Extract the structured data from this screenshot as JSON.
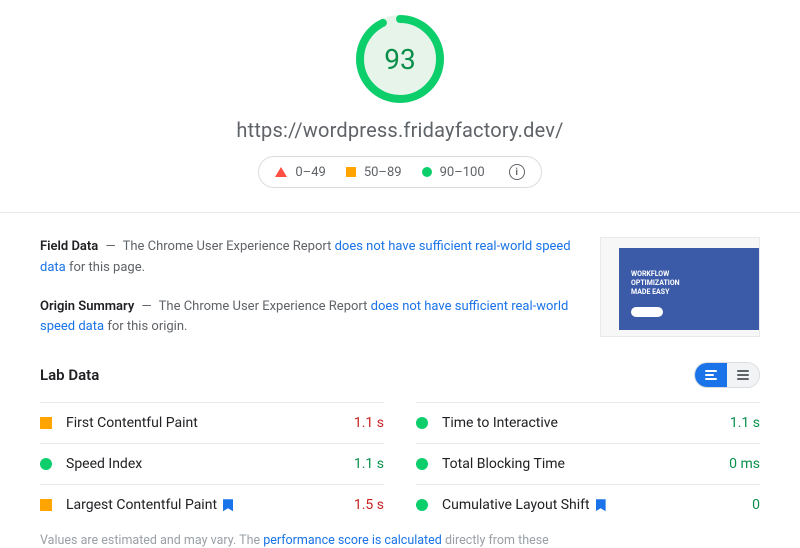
{
  "score": "93",
  "url": "https://wordpress.fridayfactory.dev/",
  "legend": {
    "poor": "0–49",
    "mid": "50–89",
    "good": "90–100"
  },
  "field_data": {
    "label": "Field Data",
    "prefix": "The Chrome User Experience Report",
    "link": "does not have sufficient real-world speed data",
    "suffix": "for this page."
  },
  "origin_summary": {
    "label": "Origin Summary",
    "prefix": "The Chrome User Experience Report",
    "link": "does not have sufficient real-world speed data",
    "suffix": "for this origin."
  },
  "thumb": {
    "line1": "WORKFLOW",
    "line2": "OPTIMIZATION",
    "line3": "MADE EASY"
  },
  "lab_label": "Lab Data",
  "metrics": [
    {
      "name": "First Contentful Paint",
      "value": "1.1 s",
      "indicator": "sq",
      "valcolor": "red",
      "ribbon": false
    },
    {
      "name": "Time to Interactive",
      "value": "1.1 s",
      "indicator": "dot",
      "valcolor": "green",
      "ribbon": false
    },
    {
      "name": "Speed Index",
      "value": "1.1 s",
      "indicator": "dot",
      "valcolor": "green",
      "ribbon": false
    },
    {
      "name": "Total Blocking Time",
      "value": "0 ms",
      "indicator": "dot",
      "valcolor": "green",
      "ribbon": false
    },
    {
      "name": "Largest Contentful Paint",
      "value": "1.5 s",
      "indicator": "sq",
      "valcolor": "red",
      "ribbon": true
    },
    {
      "name": "Cumulative Layout Shift",
      "value": "0",
      "indicator": "dot",
      "valcolor": "green",
      "ribbon": true
    }
  ],
  "footnote": {
    "prefix": "Values are estimated and may vary. The",
    "link": "performance score is calculated",
    "suffix": "directly from these"
  }
}
